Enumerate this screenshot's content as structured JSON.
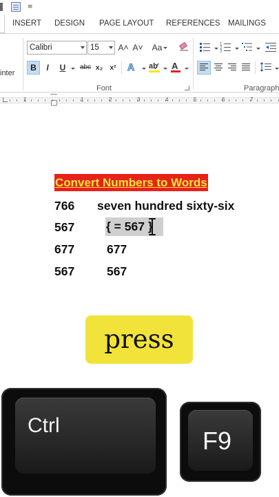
{
  "qat": {
    "more_glyph": "≡"
  },
  "ribbon_tabs": [
    "INSERT",
    "DESIGN",
    "PAGE LAYOUT",
    "REFERENCES",
    "MAILINGS"
  ],
  "font": {
    "name": "Calibri",
    "size": "15",
    "grow_label": "A˄",
    "shrink_label": "A˅",
    "case_label": "Aa",
    "bold": "B",
    "italic": "I",
    "underline": "U",
    "strike": "abc",
    "subscript": "x₂",
    "superscript": "x²",
    "group_label": "Font"
  },
  "clipboard": {
    "painter_label": "inter"
  },
  "paragraph": {
    "group_label": "Paragraph"
  },
  "ruler": {
    "labels": [
      "1",
      "1",
      "2",
      "3",
      "4",
      "5",
      "6",
      "7"
    ]
  },
  "document": {
    "heading": "Convert Numbers to Words",
    "rows": [
      {
        "number": "766",
        "value": "seven hundred sixty-six"
      },
      {
        "number": "567",
        "value": "{ = 567 }"
      },
      {
        "number": "677",
        "value": "677"
      },
      {
        "number": "567",
        "value": "567"
      }
    ]
  },
  "instruction": {
    "press_label": "press"
  },
  "keys": {
    "ctrl_label": "Ctrl",
    "f9_label": "F9"
  },
  "colors": {
    "heading_background": "#e7221a",
    "heading_text": "#ffe93a",
    "press_background": "#f2e33a",
    "field_shading": "#cfcfcf",
    "key_background": "#0c0c0c"
  }
}
